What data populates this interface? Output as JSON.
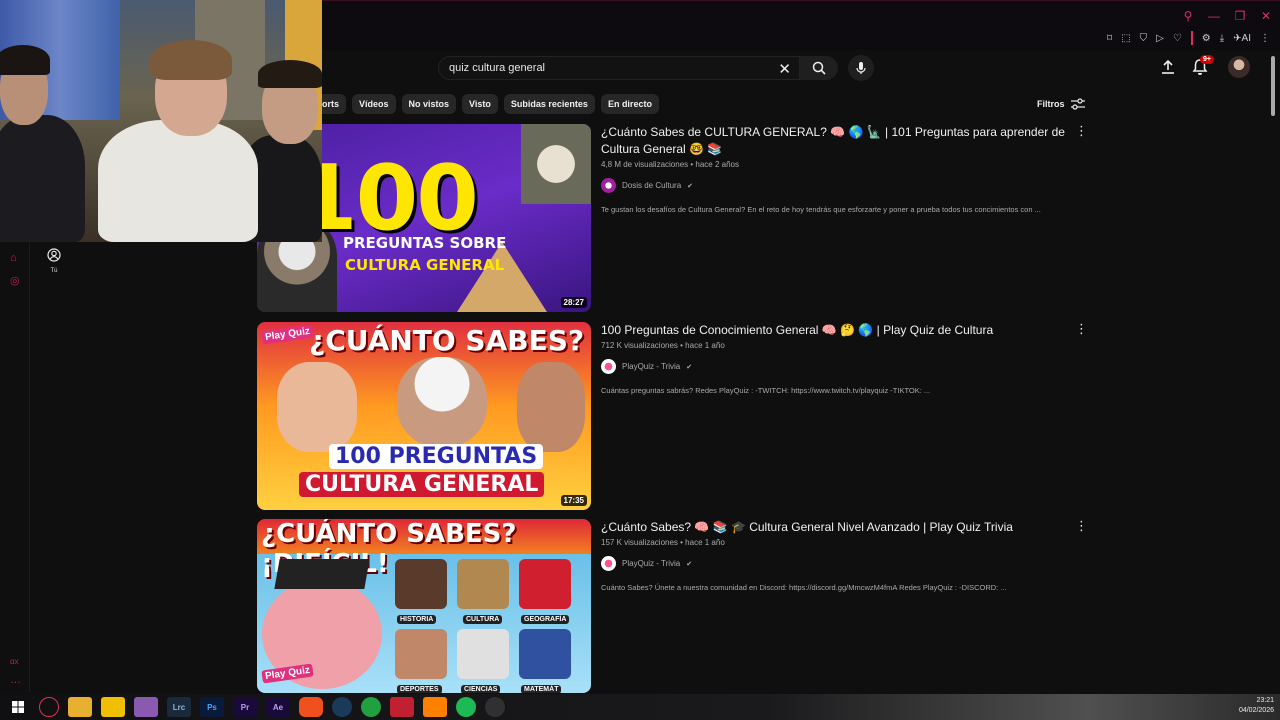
{
  "search": {
    "query": "quiz cultura general"
  },
  "notifications": {
    "badge": "9+"
  },
  "chips": [
    "orts",
    "Vídeos",
    "No vistos",
    "Visto",
    "Subidas recientes",
    "En directo"
  ],
  "filters_label": "Filtros",
  "guide": {
    "you_label": "Tú"
  },
  "videos": [
    {
      "title": "¿Cuánto Sabes de CULTURA GENERAL? 🧠 🌎 🗽 | 101 Preguntas para aprender de Cultura General 🤓 📚",
      "meta": "4,8 M de visualizaciones • hace 2 años",
      "channel": "Dosis de Cultura",
      "description": "Te gustan los desafíos de Cultura General? En el reto de hoy tendrás que esforzarte y poner a prueba todos tus concimientos con ...",
      "duration": "28:27",
      "thumb_text": {
        "big": "100",
        "line1": "PREGUNTAS SOBRE",
        "line2": "CULTURA GENERAL"
      }
    },
    {
      "title": "100 Preguntas de Conocimiento General 🧠 🤔 🌎 | Play Quiz de Cultura",
      "meta": "712 K visualizaciones • hace 1 año",
      "channel": "PlayQuiz - Trivia",
      "description": "Cuántas preguntas sabrás? Redes PlayQuiz : -TWITCH: https://www.twitch.tv/playquiz -TIKTOK: ...",
      "duration": "17:35",
      "thumb_text": {
        "badge": "Play Quiz",
        "top": "¿CUÁNTO SABES?",
        "line1": "100 PREGUNTAS",
        "line2": "CULTURA GENERAL"
      }
    },
    {
      "title": "¿Cuánto Sabes? 🧠 📚 🎓 Cultura General Nivel Avanzado | Play Quiz Trivia",
      "meta": "157 K visualizaciones • hace 1 año",
      "channel": "PlayQuiz - Trivia",
      "description": "Cuánto Sabes? Únete a nuestra comunidad en Discord: https://discord.gg/MmcwzM4fmA Redes PlayQuiz : -DISCORD: ...",
      "duration": "",
      "thumb_text": {
        "badge": "Play Quiz",
        "top": "¿CUÁNTO SABES?¡DIFÍCIL!",
        "tags": [
          "HISTORIA",
          "CULTURA",
          "GEOGRAFÍA",
          "DEPORTES",
          "CIENCIAS",
          "MATEMÁT"
        ]
      }
    }
  ],
  "taskbar": {
    "icons": [
      "Lrc",
      "Ps",
      "Pr",
      "Ae"
    ],
    "time": "23:21",
    "date": "04/02/2026"
  },
  "colors": {
    "accent": "#e0305a",
    "background": "#0f0f0f",
    "chip": "#272727"
  }
}
